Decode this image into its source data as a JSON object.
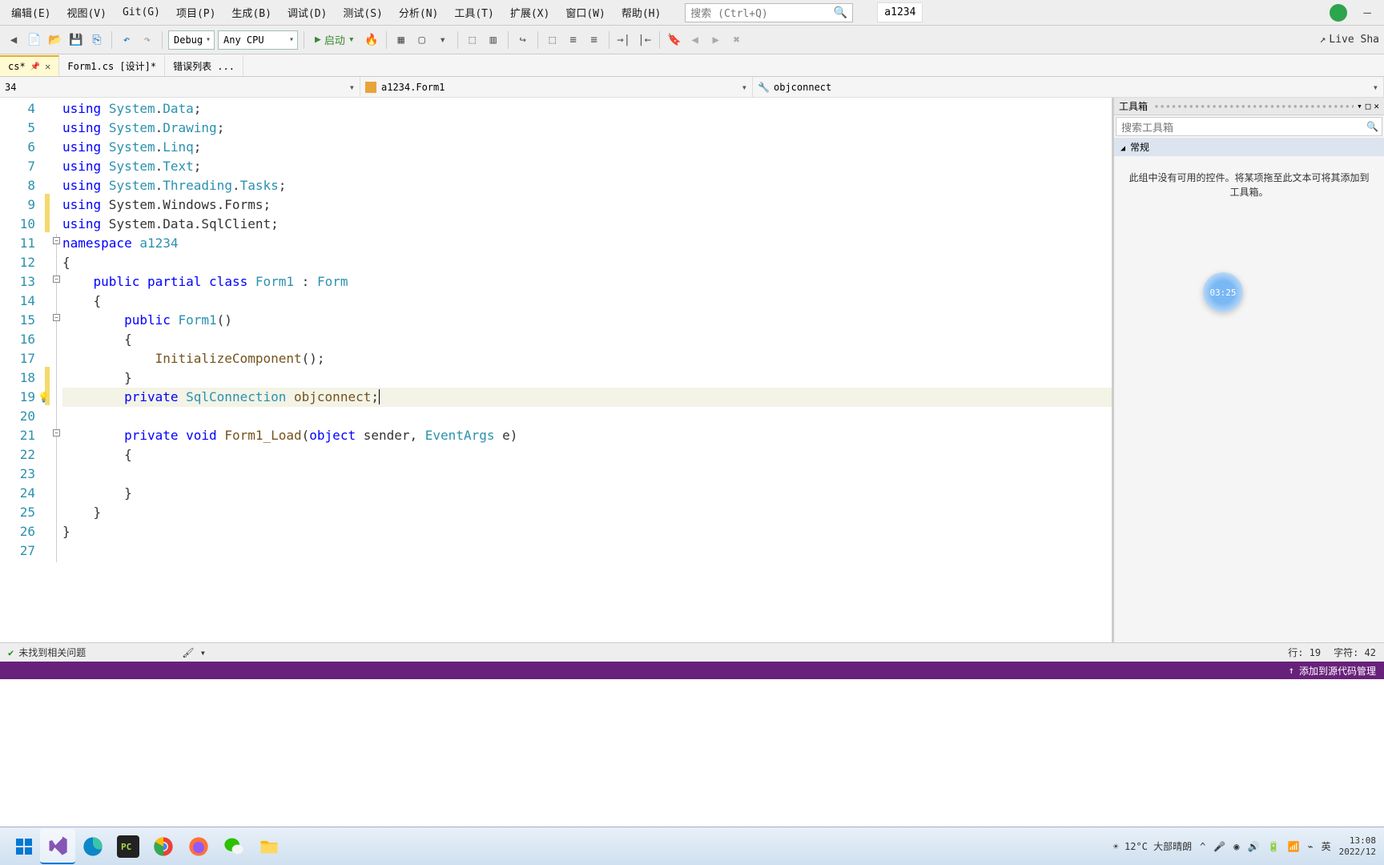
{
  "menu": {
    "edit": "编辑(E)",
    "view": "视图(V)",
    "git": "Git(G)",
    "project": "项目(P)",
    "build": "生成(B)",
    "debug": "调试(D)",
    "test": "测试(S)",
    "analyze": "分析(N)",
    "tools": "工具(T)",
    "extensions": "扩展(X)",
    "window": "窗口(W)",
    "help": "帮助(H)"
  },
  "search_placeholder": "搜索 (Ctrl+Q)",
  "project_name": "a1234",
  "config": "Debug",
  "platform": "Any CPU",
  "run_label": "启动",
  "live_share": "Live Sha",
  "tabs": [
    {
      "label": "cs*",
      "active": true
    },
    {
      "label": "Form1.cs [设计]*"
    },
    {
      "label": "错误列表 ..."
    }
  ],
  "nav": {
    "left": "34",
    "mid": "a1234.Form1",
    "right": "objconnect"
  },
  "code_lines": [
    {
      "n": 4,
      "tokens": [
        [
          "kw",
          "using"
        ],
        [
          "txt",
          " "
        ],
        [
          "typ",
          "System"
        ],
        [
          "txt",
          "."
        ],
        [
          "typ",
          "Data"
        ],
        [
          "txt",
          ";"
        ]
      ]
    },
    {
      "n": 5,
      "tokens": [
        [
          "kw",
          "using"
        ],
        [
          "txt",
          " "
        ],
        [
          "typ",
          "System"
        ],
        [
          "txt",
          "."
        ],
        [
          "typ",
          "Drawing"
        ],
        [
          "txt",
          ";"
        ]
      ]
    },
    {
      "n": 6,
      "tokens": [
        [
          "kw",
          "using"
        ],
        [
          "txt",
          " "
        ],
        [
          "typ",
          "System"
        ],
        [
          "txt",
          "."
        ],
        [
          "typ",
          "Linq"
        ],
        [
          "txt",
          ";"
        ]
      ]
    },
    {
      "n": 7,
      "tokens": [
        [
          "kw",
          "using"
        ],
        [
          "txt",
          " "
        ],
        [
          "typ",
          "System"
        ],
        [
          "txt",
          "."
        ],
        [
          "typ",
          "Text"
        ],
        [
          "txt",
          ";"
        ]
      ]
    },
    {
      "n": 8,
      "tokens": [
        [
          "kw",
          "using"
        ],
        [
          "txt",
          " "
        ],
        [
          "typ",
          "System"
        ],
        [
          "txt",
          "."
        ],
        [
          "typ",
          "Threading"
        ],
        [
          "txt",
          "."
        ],
        [
          "typ",
          "Tasks"
        ],
        [
          "txt",
          ";"
        ]
      ]
    },
    {
      "n": 9,
      "mark": "y",
      "tokens": [
        [
          "kw",
          "using"
        ],
        [
          "txt",
          " System.Windows.Forms;"
        ]
      ]
    },
    {
      "n": 10,
      "mark": "y",
      "tokens": [
        [
          "kw",
          "using"
        ],
        [
          "txt",
          " System.Data.SqlClient;"
        ]
      ]
    },
    {
      "n": 11,
      "fold": "-",
      "tokens": [
        [
          "kw",
          "namespace"
        ],
        [
          "txt",
          " "
        ],
        [
          "typ",
          "a1234"
        ]
      ]
    },
    {
      "n": 12,
      "tokens": [
        [
          "txt",
          "{"
        ]
      ]
    },
    {
      "n": 13,
      "fold": "-",
      "tokens": [
        [
          "txt",
          "    "
        ],
        [
          "kw",
          "public"
        ],
        [
          "txt",
          " "
        ],
        [
          "kw",
          "partial"
        ],
        [
          "txt",
          " "
        ],
        [
          "kw",
          "class"
        ],
        [
          "txt",
          " "
        ],
        [
          "typ",
          "Form1"
        ],
        [
          "txt",
          " : "
        ],
        [
          "typ",
          "Form"
        ]
      ]
    },
    {
      "n": 14,
      "tokens": [
        [
          "txt",
          "    {"
        ]
      ]
    },
    {
      "n": 15,
      "fold": "-",
      "tokens": [
        [
          "txt",
          "        "
        ],
        [
          "kw",
          "public"
        ],
        [
          "txt",
          " "
        ],
        [
          "typ",
          "Form1"
        ],
        [
          "txt",
          "()"
        ]
      ]
    },
    {
      "n": 16,
      "tokens": [
        [
          "txt",
          "        {"
        ]
      ]
    },
    {
      "n": 17,
      "tokens": [
        [
          "txt",
          "            "
        ],
        [
          "mtd",
          "InitializeComponent"
        ],
        [
          "txt",
          "();"
        ]
      ]
    },
    {
      "n": 18,
      "mark": "y",
      "tokens": [
        [
          "txt",
          "        }"
        ]
      ]
    },
    {
      "n": 19,
      "mark": "y",
      "hl": true,
      "bulb": true,
      "tokens": [
        [
          "txt",
          "        "
        ],
        [
          "kw",
          "private"
        ],
        [
          "txt",
          " "
        ],
        [
          "typ",
          "SqlConnection"
        ],
        [
          "txt",
          " "
        ],
        [
          "fld",
          "objconnect"
        ],
        [
          "txt",
          ";"
        ]
      ],
      "cursor": true
    },
    {
      "n": 20,
      "tokens": [
        [
          "txt",
          ""
        ]
      ]
    },
    {
      "n": 21,
      "fold": "-",
      "tokens": [
        [
          "txt",
          "        "
        ],
        [
          "kw",
          "private"
        ],
        [
          "txt",
          " "
        ],
        [
          "kw",
          "void"
        ],
        [
          "txt",
          " "
        ],
        [
          "mtd",
          "Form1_Load"
        ],
        [
          "txt",
          "("
        ],
        [
          "kw",
          "object"
        ],
        [
          "txt",
          " sender, "
        ],
        [
          "typ",
          "EventArgs"
        ],
        [
          "txt",
          " e)"
        ]
      ]
    },
    {
      "n": 22,
      "tokens": [
        [
          "txt",
          "        {"
        ]
      ]
    },
    {
      "n": 23,
      "tokens": [
        [
          "txt",
          ""
        ]
      ]
    },
    {
      "n": 24,
      "tokens": [
        [
          "txt",
          "        }"
        ]
      ]
    },
    {
      "n": 25,
      "tokens": [
        [
          "txt",
          "    }"
        ]
      ]
    },
    {
      "n": 26,
      "tokens": [
        [
          "txt",
          "}"
        ]
      ]
    },
    {
      "n": 27,
      "tokens": [
        [
          "txt",
          ""
        ]
      ]
    }
  ],
  "toolbox": {
    "title": "工具箱",
    "search": "搜索工具箱",
    "category": "常规",
    "message": "此组中没有可用的控件。将某项拖至此文本可将其添加到工具箱。"
  },
  "timer": "03:25",
  "status": {
    "noissues": "未找到相关问题",
    "line": "行: 19",
    "col": "字符: 42"
  },
  "srcctrl": "添加到源代码管理",
  "weather": "12°C 大部晴朗",
  "ime": "英",
  "time": "13:08",
  "date": "2022/12"
}
